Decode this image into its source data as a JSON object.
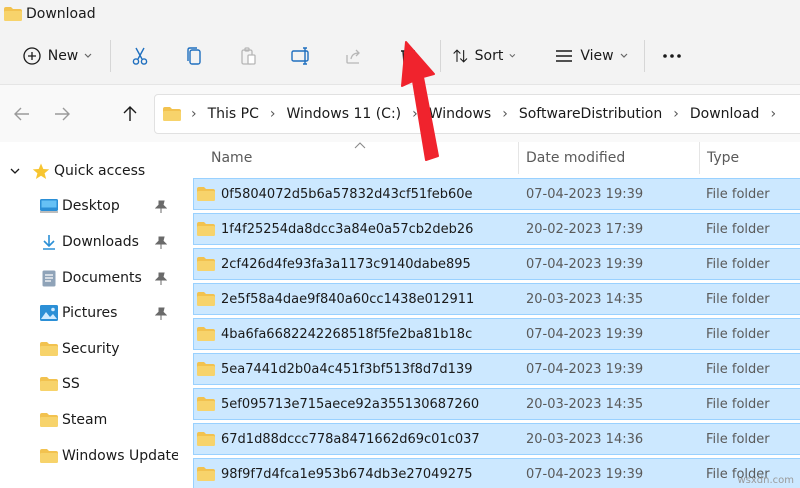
{
  "window": {
    "title": "Download"
  },
  "toolbar": {
    "new_label": "New",
    "sort_label": "Sort",
    "view_label": "View",
    "buttons": [
      "cut-icon",
      "copy-icon",
      "paste-icon",
      "rename-icon",
      "share-icon",
      "delete-icon",
      "more-icon"
    ]
  },
  "address": {
    "crumbs": [
      "This PC",
      "Windows 11 (C:)",
      "Windows",
      "SoftwareDistribution",
      "Download"
    ]
  },
  "nav": {
    "items": [
      {
        "label": "Quick access",
        "icon": "star-icon"
      },
      {
        "label": "Desktop",
        "icon": "desktop-icon",
        "pinned": true
      },
      {
        "label": "Downloads",
        "icon": "download-icon",
        "pinned": true
      },
      {
        "label": "Documents",
        "icon": "documents-icon",
        "pinned": true
      },
      {
        "label": "Pictures",
        "icon": "pictures-icon",
        "pinned": true
      },
      {
        "label": "Security",
        "icon": "folder-icon"
      },
      {
        "label": "SS",
        "icon": "folder-icon"
      },
      {
        "label": "Steam",
        "icon": "folder-icon"
      },
      {
        "label": "Windows Update",
        "icon": "folder-icon"
      }
    ]
  },
  "list": {
    "columns": {
      "name": "Name",
      "date": "Date modified",
      "type": "Type"
    },
    "rows": [
      {
        "name": "0f5804072d5b6a57832d43cf51feb60e",
        "date": "07-04-2023 19:39",
        "type": "File folder"
      },
      {
        "name": "1f4f25254da8dcc3a84e0a57cb2deb26",
        "date": "20-02-2023 17:39",
        "type": "File folder"
      },
      {
        "name": "2cf426d4fe93fa3a1173c9140dabe895",
        "date": "07-04-2023 19:39",
        "type": "File folder"
      },
      {
        "name": "2e5f58a4dae9f840a60cc1438e012911",
        "date": "20-03-2023 14:35",
        "type": "File folder"
      },
      {
        "name": "4ba6fa6682242268518f5fe2ba81b18c",
        "date": "07-04-2023 19:39",
        "type": "File folder"
      },
      {
        "name": "5ea7441d2b0a4c451f3bf513f8d7d139",
        "date": "07-04-2023 19:39",
        "type": "File folder"
      },
      {
        "name": "5ef095713e715aece92a355130687260",
        "date": "20-03-2023 14:35",
        "type": "File folder"
      },
      {
        "name": "67d1d88dccc778a8471662d69c01c037",
        "date": "20-03-2023 14:36",
        "type": "File folder"
      },
      {
        "name": "98f9f7d4fca1e953b674db3e27049275",
        "date": "07-04-2023 19:39",
        "type": "File folder"
      }
    ]
  },
  "colors": {
    "selection": "#cce8ff",
    "selection_border": "#99d1ff",
    "folder": "#f2c24f",
    "annotation": "#f0232d"
  },
  "watermark": "wsxdn.com"
}
